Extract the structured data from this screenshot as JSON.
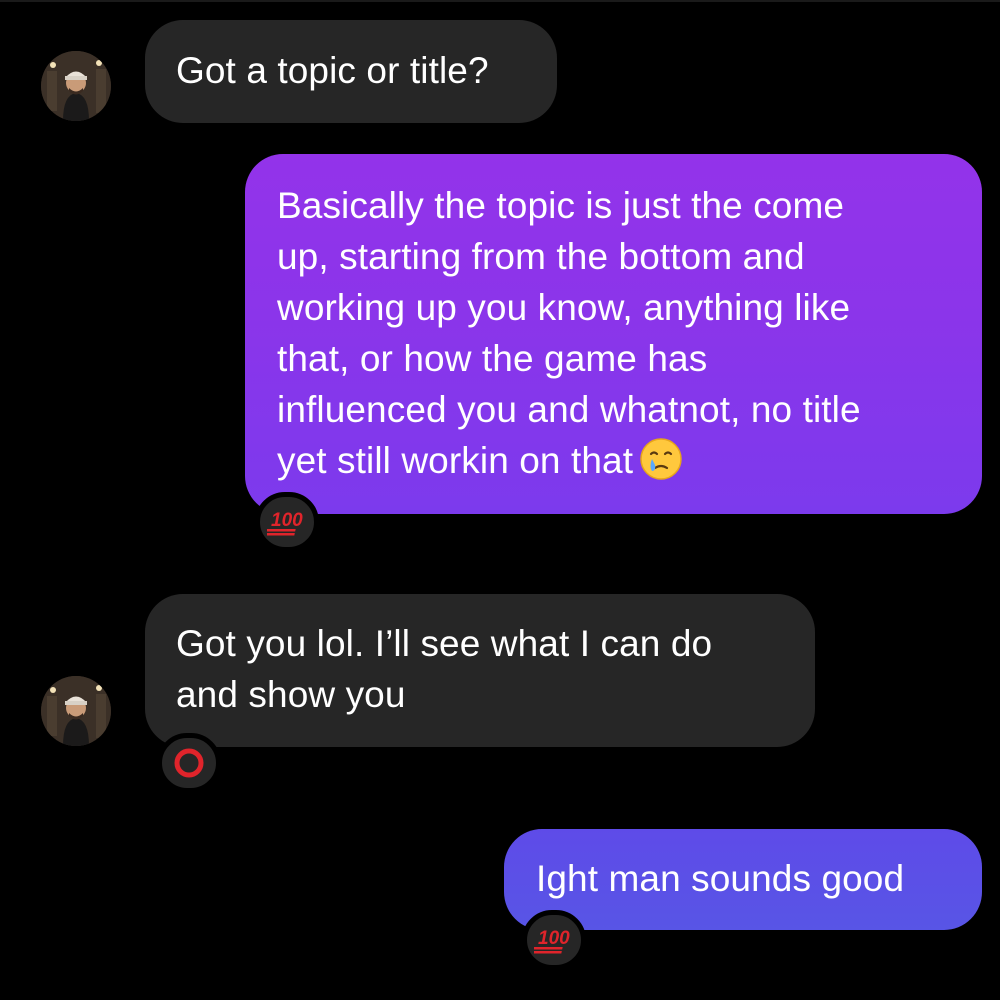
{
  "colors": {
    "background": "#000000",
    "incoming_bubble": "#262626",
    "outgoing_gradient_top": "#9333ea",
    "outgoing_gradient_bottom": "#7c3aed",
    "outgoing_short": "#5b4ee6"
  },
  "messages": [
    {
      "direction": "incoming",
      "lines": [
        "Got a topic or title?"
      ],
      "avatar": "profile-photo",
      "reaction": null
    },
    {
      "direction": "outgoing",
      "lines": [
        "Basically the topic is just the come",
        "up, starting from the bottom and",
        "working up you know, anything like",
        "that, or how the game has",
        "influenced you and whatnot, no title",
        "yet still workin on that"
      ],
      "trailing_emoji": "face-holding-back-tears-emoji",
      "reaction": "hundred-points-emoji"
    },
    {
      "direction": "incoming",
      "lines": [
        "Got you lol. I’ll see what I can do",
        "and show you"
      ],
      "avatar": "profile-photo",
      "reaction": "hollow-red-circle-emoji"
    },
    {
      "direction": "outgoing",
      "lines": [
        "Ight man sounds good"
      ],
      "reaction": "hundred-points-emoji"
    }
  ]
}
